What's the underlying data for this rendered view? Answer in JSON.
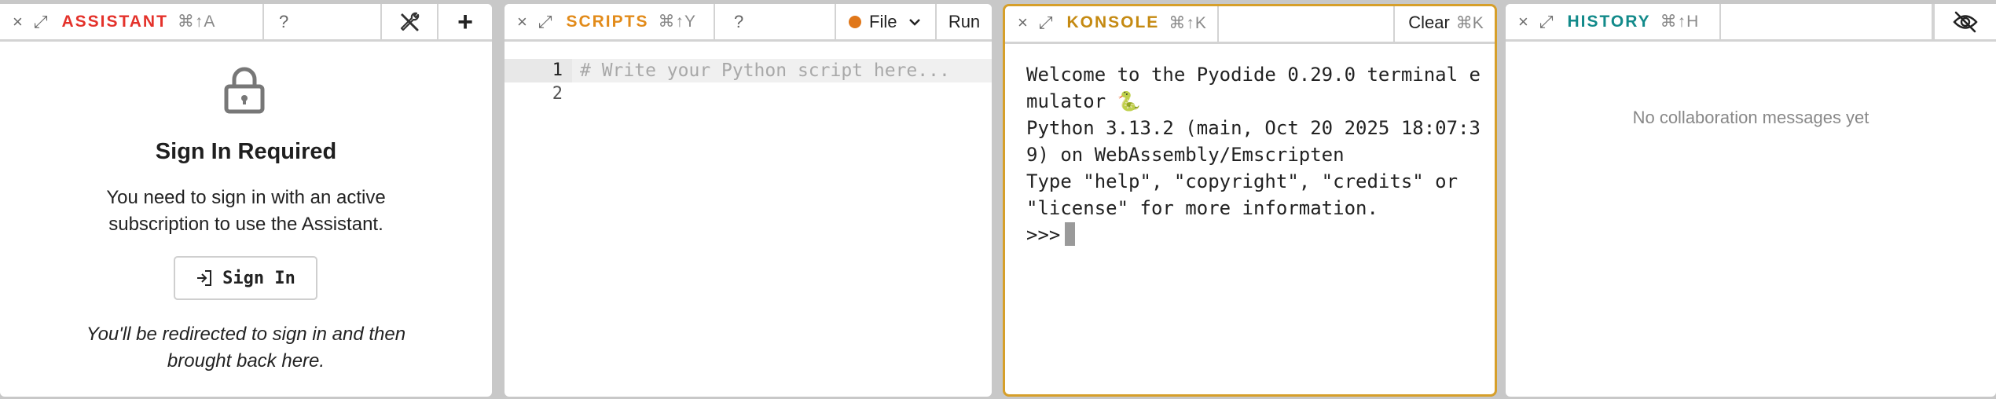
{
  "colors": {
    "assistant_title": "#e4322b",
    "scripts_title": "#e28b1a",
    "konsole_title": "#c58a12",
    "history_title": "#128a8a",
    "active_border": "#d69f2a",
    "file_dot": "#e0771a"
  },
  "assistant": {
    "title": "ASSISTANT",
    "shortcut": "⌘↑A",
    "help": "?",
    "heading": "Sign In Required",
    "desc_line1": "You need to sign in with an active",
    "desc_line2": "subscription to use the Assistant.",
    "signin_label": "Sign In",
    "redirect_line1": "You'll be redirected to sign in and then",
    "redirect_line2": "brought back here."
  },
  "scripts": {
    "title": "SCRIPTS",
    "shortcut": "⌘↑Y",
    "help": "?",
    "file_label": "File",
    "run_label": "Run",
    "line_numbers": [
      "1",
      "2"
    ],
    "placeholder": "# Write your Python script here..."
  },
  "konsole": {
    "title": "KONSOLE",
    "shortcut": "⌘↑K",
    "clear_label": "Clear",
    "clear_shortcut": "⌘K",
    "output": "Welcome to the Pyodide 0.29.0 terminal emulator 🐍\nPython 3.13.2 (main, Oct 20 2025 18:07:39) on WebAssembly/Emscripten\nType \"help\", \"copyright\", \"credits\" or \"license\" for more information.\n",
    "prompt": ">>>"
  },
  "history": {
    "title": "HISTORY",
    "shortcut": "⌘↑H",
    "empty_message": "No collaboration messages yet"
  },
  "icons": {
    "close": "×",
    "expand": "⤢",
    "plus": "+"
  }
}
